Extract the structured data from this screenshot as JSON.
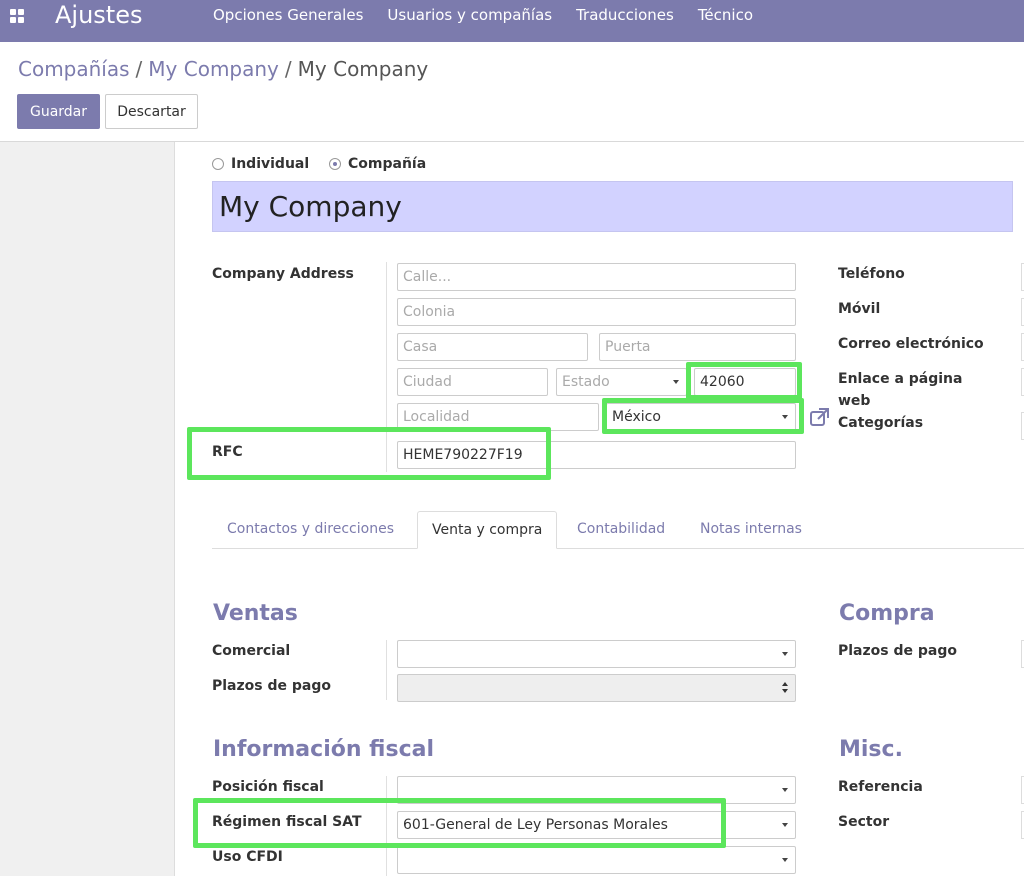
{
  "navbar": {
    "app_title": "Ajustes",
    "menu": [
      "Opciones Generales",
      "Usuarios y compañías",
      "Traducciones",
      "Técnico"
    ],
    "color": "#7c7bad"
  },
  "breadcrumb": {
    "item1": "Compañías",
    "item2": "My Company",
    "current": "My Company",
    "separator": "/"
  },
  "buttons": {
    "save": "Guardar",
    "discard": "Descartar"
  },
  "type_radio": {
    "individual": "Individual",
    "company": "Compañía",
    "selected": "Compañía"
  },
  "company_name": "My Company",
  "address": {
    "label": "Company Address",
    "street_placeholder": "Calle...",
    "colonia_placeholder": "Colonia",
    "casa_placeholder": "Casa",
    "puerta_placeholder": "Puerta",
    "ciudad_placeholder": "Ciudad",
    "estado_placeholder": "Estado",
    "zip": "42060",
    "localidad_placeholder": "Localidad",
    "country": "México"
  },
  "rfc": {
    "label": "RFC",
    "value": "HEME790227F19"
  },
  "right_labels": {
    "phone": "Teléfono",
    "mobile": "Móvil",
    "email": "Correo electrónico",
    "website_line1": "Enlace a página",
    "website_line2": "web",
    "categories": "Categorías"
  },
  "tabs": {
    "contacts": "Contactos y direcciones",
    "sales_purchase": "Venta y compra",
    "accounting": "Contabilidad",
    "notes": "Notas internas",
    "active": "Venta y compra"
  },
  "ventas": {
    "title": "Ventas",
    "comercial": "Comercial",
    "plazos": "Plazos de pago"
  },
  "compra": {
    "title": "Compra",
    "plazos": "Plazos de pago"
  },
  "fiscal": {
    "title": "Información fiscal",
    "posicion": "Posición fiscal",
    "regimen": "Régimen fiscal SAT",
    "regimen_value": "601-General de Ley Personas Morales",
    "uso_cfdi": "Uso CFDI"
  },
  "misc": {
    "title": "Misc.",
    "referencia": "Referencia",
    "sector": "Sector"
  },
  "highlight_color": "#5ce65c",
  "icons": [
    "apps-grid-icon",
    "external-link-icon",
    "dropdown-caret-icon",
    "updown-spinner-icon"
  ]
}
